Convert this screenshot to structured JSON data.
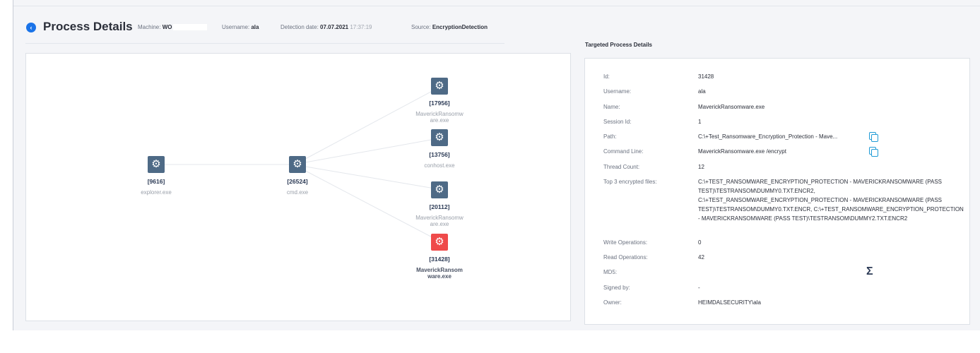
{
  "header": {
    "back_icon": "‹",
    "title": "Process Details",
    "machine_label": "Machine:",
    "machine_value": "WO",
    "username_label": "Username:",
    "username_value": "ala",
    "detection_label": "Detection date:",
    "detection_date": "07.07.2021",
    "detection_time": "17:37:19",
    "source_label": "Source:",
    "source_value": "EncryptionDetection"
  },
  "graph": {
    "nodes": [
      {
        "pid": "[9616]",
        "name": "explorer.exe"
      },
      {
        "pid": "[26524]",
        "name": "cmd.exe"
      },
      {
        "pid": "[17956]",
        "name": "MaverickRansomw are.exe"
      },
      {
        "pid": "[13756]",
        "name": "conhost.exe"
      },
      {
        "pid": "[20112]",
        "name": "MaverickRansomw are.exe"
      },
      {
        "pid": "[31428]",
        "name": "MaverickRansom ware.exe"
      }
    ]
  },
  "details": {
    "section_title": "Targeted Process Details",
    "id_label": "Id:",
    "id_value": "31428",
    "username_label": "Username:",
    "username_value": "ala",
    "name_label": "Name:",
    "name_value": "MaverickRansomware.exe",
    "session_label": "Session Id:",
    "session_value": "1",
    "path_label": "Path:",
    "path_value": "C:\\+Test_Ransomware_Encryption_Protection - Mave...",
    "cmd_label": "Command Line:",
    "cmd_value": "MaverickRansomware.exe /encrypt",
    "thread_label": "Thread Count:",
    "thread_value": "12",
    "top3_label": "Top 3 encrypted files:",
    "top3_value": "C:\\+TEST_RANSOMWARE_ENCRYPTION_PROTECTION - MAVERICKRANSOMWARE (PASS TEST)\\TESTRANSOM\\DUMMY0.TXT.ENCR2, C:\\+TEST_RANSOMWARE_ENCRYPTION_PROTECTION - MAVERICKRANSOMWARE (PASS TEST)\\TESTRANSOM\\DUMMY0.TXT.ENCR, C:\\+TEST_RANSOMWARE_ENCRYPTION_PROTECTION - MAVERICKRANSOMWARE (PASS TEST)\\TESTRANSOM\\DUMMY2.TXT.ENCR2",
    "write_label": "Write Operations:",
    "write_value": "0",
    "read_label": "Read Operations:",
    "read_value": "42",
    "md5_label": "MD5:",
    "md5_icon": "Σ",
    "signed_label": "Signed by:",
    "signed_value": "-",
    "owner_label": "Owner:",
    "owner_value": "HEIMDALSECURITY\\ala"
  }
}
